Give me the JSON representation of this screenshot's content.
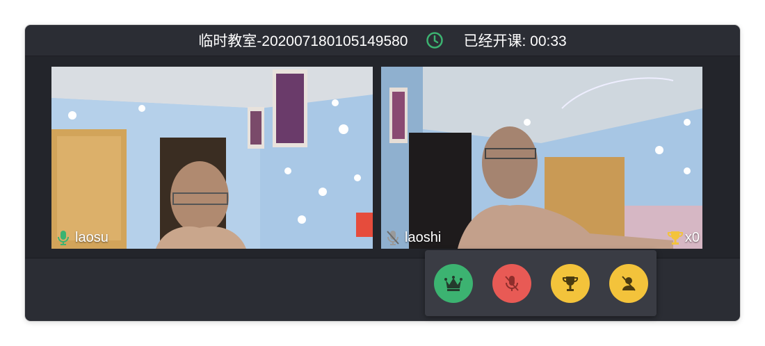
{
  "header": {
    "room_title": "临时教室-202007180105149580",
    "elapsed_label": "已经开课: 00:33"
  },
  "participants": [
    {
      "name": "laosu",
      "mic_status": "active"
    },
    {
      "name": "laoshi",
      "mic_status": "muted",
      "trophy_count": "x0"
    }
  ],
  "action_menu": {
    "buttons": [
      {
        "id": "crown",
        "icon": "crown-icon",
        "color": "#3cb371"
      },
      {
        "id": "mute",
        "icon": "mic-off-icon",
        "color": "#e85a55"
      },
      {
        "id": "trophy",
        "icon": "trophy-icon",
        "color": "#f3c33b"
      },
      {
        "id": "remove",
        "icon": "person-off-icon",
        "color": "#f3c33b"
      }
    ]
  },
  "colors": {
    "accent_green": "#3cb371",
    "danger_red": "#e85a55",
    "gold": "#f3c33b",
    "window_bg": "#2b2d34"
  }
}
